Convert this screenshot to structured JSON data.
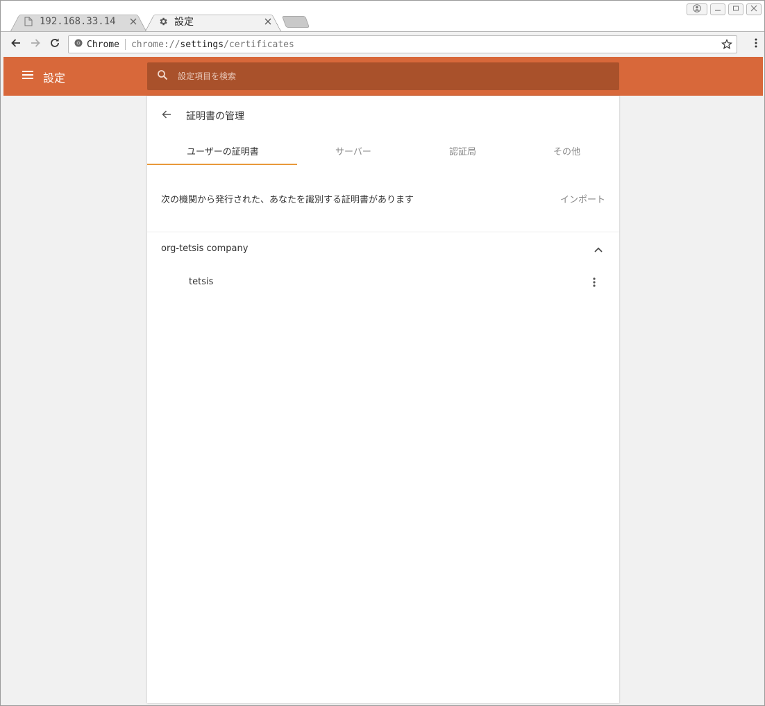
{
  "tabs": [
    {
      "title": "192.168.33.14",
      "icon": "page-icon",
      "active": false
    },
    {
      "title": "設定",
      "icon": "gear-icon",
      "active": true
    }
  ],
  "omnibox": {
    "chip": "Chrome",
    "url_prefix": "chrome://",
    "url_host": "settings",
    "url_path": "/certificates"
  },
  "header": {
    "title": "設定",
    "search_placeholder": "設定項目を検索"
  },
  "page": {
    "title": "証明書の管理",
    "tabs": [
      "ユーザーの証明書",
      "サーバー",
      "認証局",
      "その他"
    ],
    "description": "次の機関から発行された、あなたを識別する証明書があります",
    "import_label": "インポート",
    "org": "org-tetsis company",
    "certificate": "tetsis"
  },
  "colors": {
    "header": "#d8683a",
    "search": "#a9512b",
    "tab_indicator": "#e8993b"
  }
}
